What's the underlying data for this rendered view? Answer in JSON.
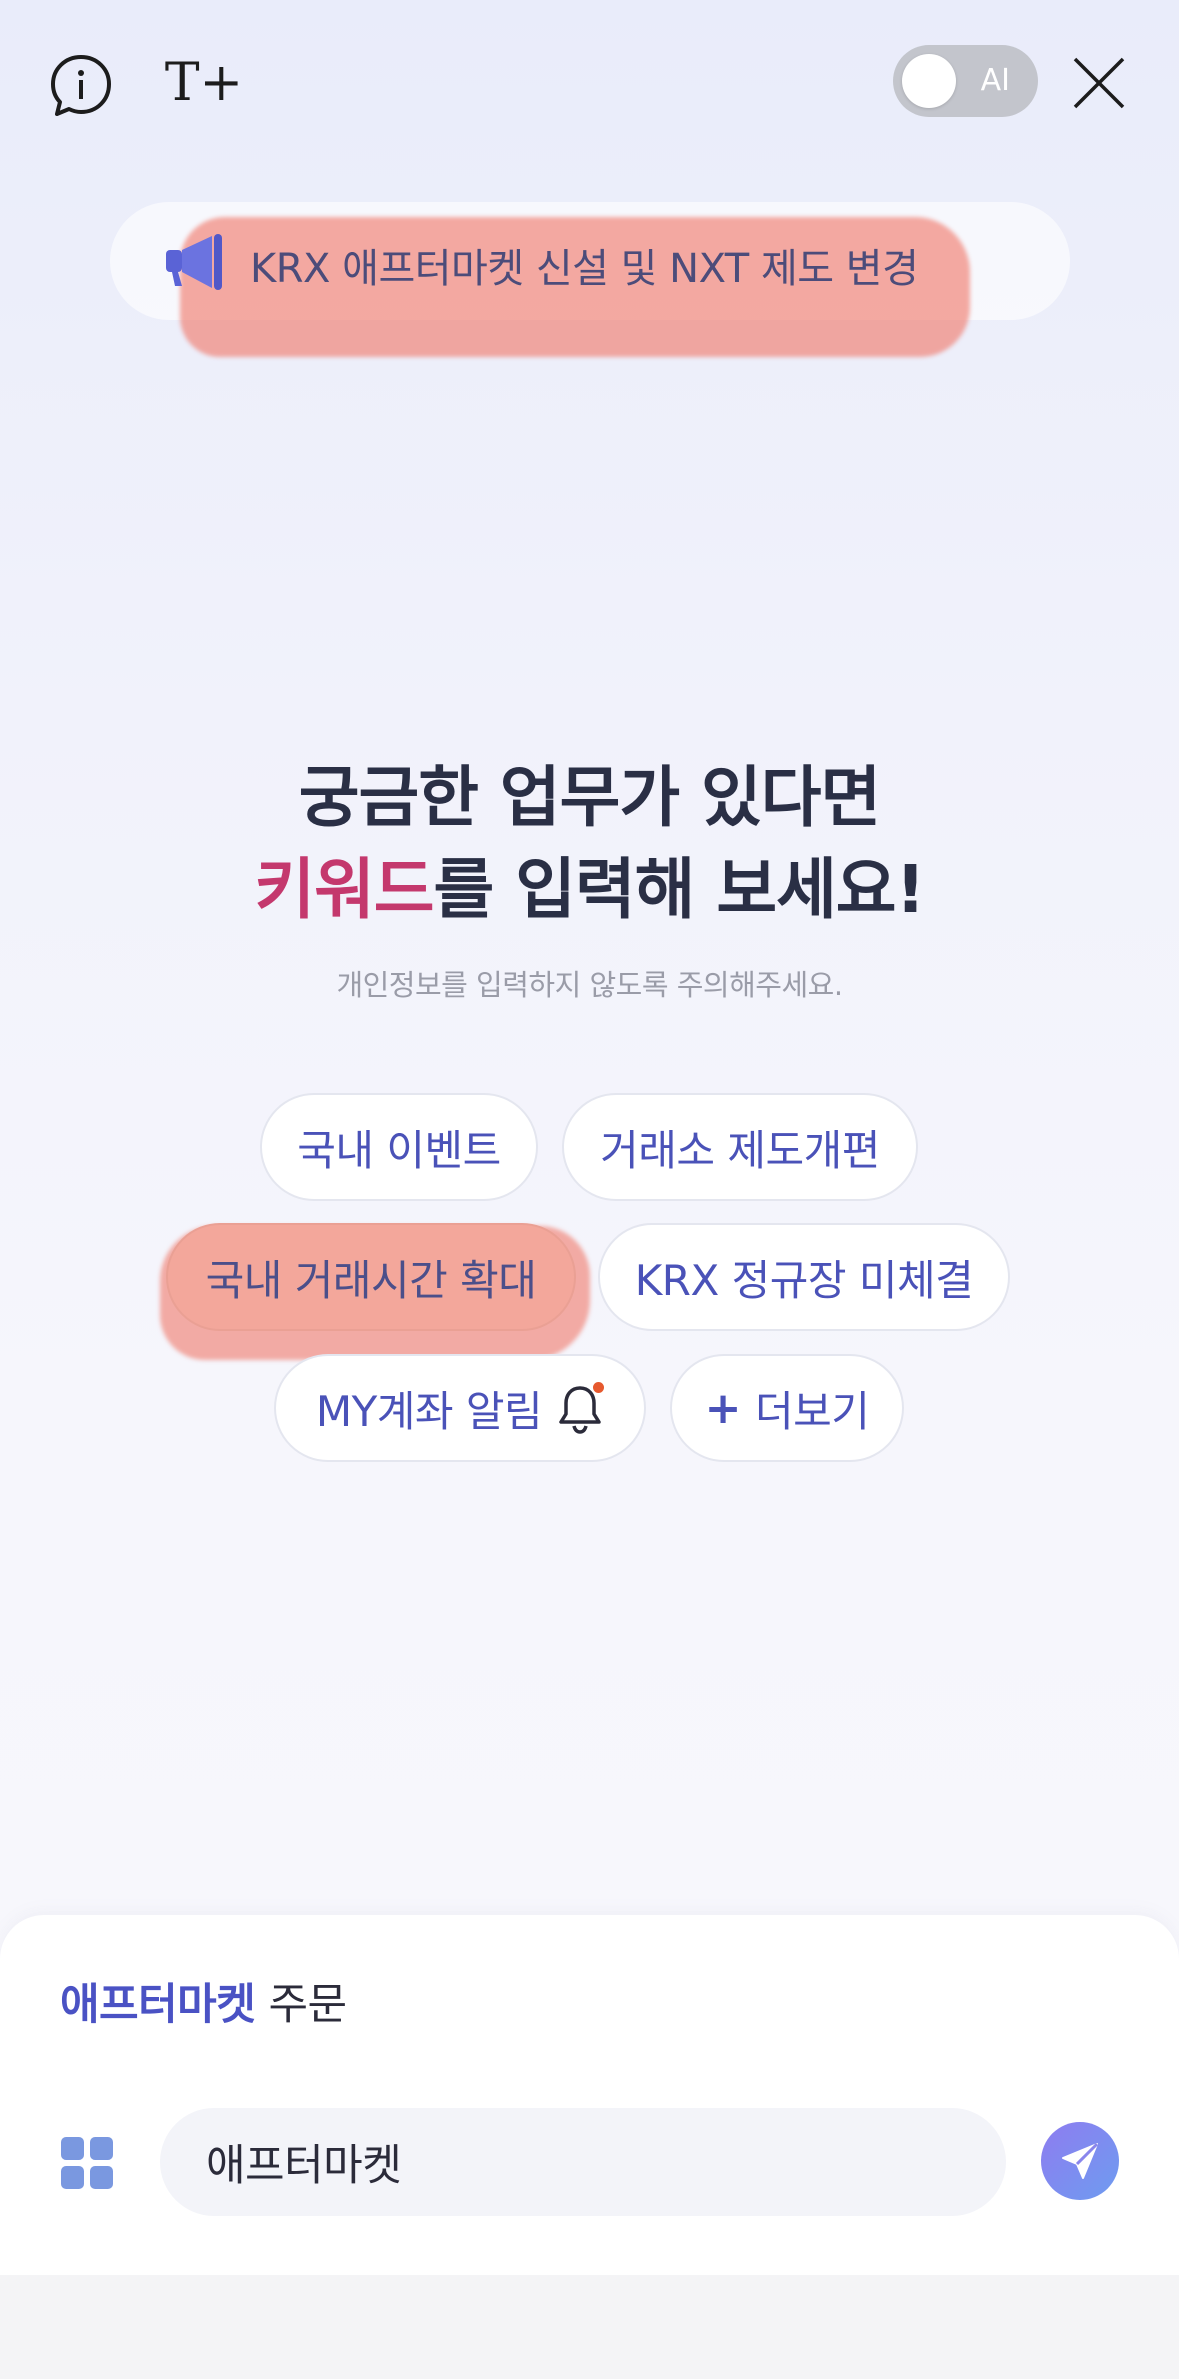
{
  "topbar": {
    "info_icon": "info-bubble-icon",
    "textsize_label": "T+",
    "ai_toggle_label": "AI",
    "ai_toggle_on": false,
    "close_icon": "close-icon"
  },
  "notice": {
    "icon": "megaphone-icon",
    "text": "KRX 애프터마켓 신설 및 NXT 제도 변경"
  },
  "hero": {
    "line1": "궁금한 업무가 있다면",
    "line2_keyword": "키워드",
    "line2_rest": "를 입력해 보세요!",
    "subtitle": "개인정보를 입력하지 않도록 주의해주세요."
  },
  "chips": [
    {
      "label": "국내 이벤트"
    },
    {
      "label": "거래소 제도개편"
    },
    {
      "label": "국내 거래시간 확대"
    },
    {
      "label": "KRX 정규장 미체결"
    },
    {
      "label": "MY계좌 알림"
    },
    {
      "label": "더보기",
      "prefix": "+"
    }
  ],
  "composer": {
    "suggestion_bold": "애프터마켓",
    "suggestion_rest": " 주문",
    "input_value": "애프터마켓",
    "menu_icon": "grid-menu-icon",
    "send_icon": "send-arrow-icon"
  },
  "colors": {
    "accent": "#4a52b8",
    "keyword": "#c4386d",
    "highlight": "#f0786a"
  }
}
